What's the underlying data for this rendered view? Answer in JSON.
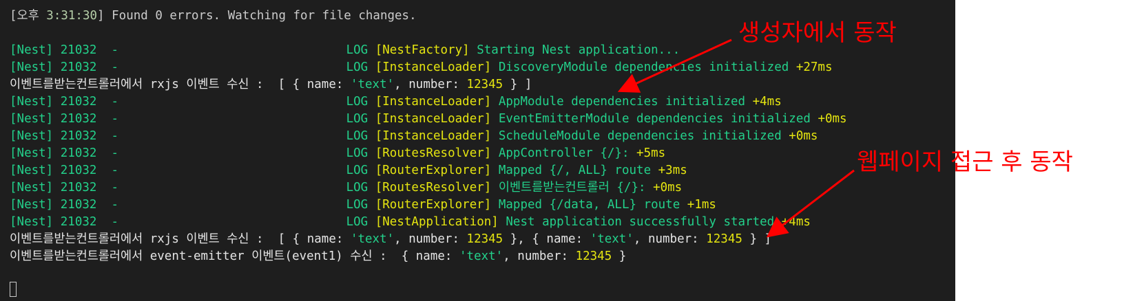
{
  "terminal": {
    "watch_line": {
      "prefix": "[오후 ",
      "time": "3:31:30",
      "suffix": "] Found 0 errors. Watching for file changes."
    },
    "log_rows": [
      {
        "pid": "[Nest] 21032  - ",
        "level": "LOG",
        "context": "[NestFactory]",
        "message": " Starting Nest application...",
        "ms": ""
      },
      {
        "pid": "[Nest] 21032  - ",
        "level": "LOG",
        "context": "[InstanceLoader]",
        "message": " DiscoveryModule dependencies initialized ",
        "ms": "+27ms"
      },
      {
        "pid": "[Nest] 21032  - ",
        "level": "LOG",
        "context": "[InstanceLoader]",
        "message": " AppModule dependencies initialized ",
        "ms": "+4ms"
      },
      {
        "pid": "[Nest] 21032  - ",
        "level": "LOG",
        "context": "[InstanceLoader]",
        "message": " EventEmitterModule dependencies initialized ",
        "ms": "+0ms"
      },
      {
        "pid": "[Nest] 21032  - ",
        "level": "LOG",
        "context": "[InstanceLoader]",
        "message": " ScheduleModule dependencies initialized ",
        "ms": "+0ms"
      },
      {
        "pid": "[Nest] 21032  - ",
        "level": "LOG",
        "context": "[RoutesResolver]",
        "message": " AppController {/}: ",
        "ms": "+5ms"
      },
      {
        "pid": "[Nest] 21032  - ",
        "level": "LOG",
        "context": "[RouterExplorer]",
        "message": " Mapped {/, ALL} route ",
        "ms": "+3ms"
      },
      {
        "pid": "[Nest] 21032  - ",
        "level": "LOG",
        "context": "[RoutesResolver]",
        "message": " 이벤트를받는컨트롤러 {/}: ",
        "ms": "+0ms"
      },
      {
        "pid": "[Nest] 21032  - ",
        "level": "LOG",
        "context": "[RouterExplorer]",
        "message": " Mapped {/data, ALL} route ",
        "ms": "+1ms"
      },
      {
        "pid": "[Nest] 21032  - ",
        "level": "LOG",
        "context": "[NestApplication]",
        "message": " Nest application successfully started ",
        "ms": "+4ms"
      }
    ],
    "console_1": {
      "prefix": "이벤트를받는컨트롤러에서 rxjs 이벤트 수신 :  [ { name: ",
      "str": "'text'",
      "mid": ", number: ",
      "num": "12345",
      "end": " } ]"
    },
    "console_2": {
      "prefix": "이벤트를받는컨트롤러에서 rxjs 이벤트 수신 :  [ { name: ",
      "str1": "'text'",
      "mid1": ", number: ",
      "num1": "12345",
      "sep": " }, { name: ",
      "str2": "'text'",
      "mid2": ", number: ",
      "num2": "12345",
      "end": " } ]"
    },
    "console_3": {
      "prefix": "이벤트를받는컨트롤러에서 event-emitter 이벤트(event1) 수신 :  { name: ",
      "str": "'text'",
      "mid": ", number: ",
      "num": "12345",
      "end": " }"
    }
  },
  "annotations": {
    "constructor_label": "생성자에서 동작",
    "webpage_label": "웹페이지 접근 후 동작"
  },
  "colors": {
    "background": "#1e1e1e",
    "annotation": "#ff0000"
  }
}
